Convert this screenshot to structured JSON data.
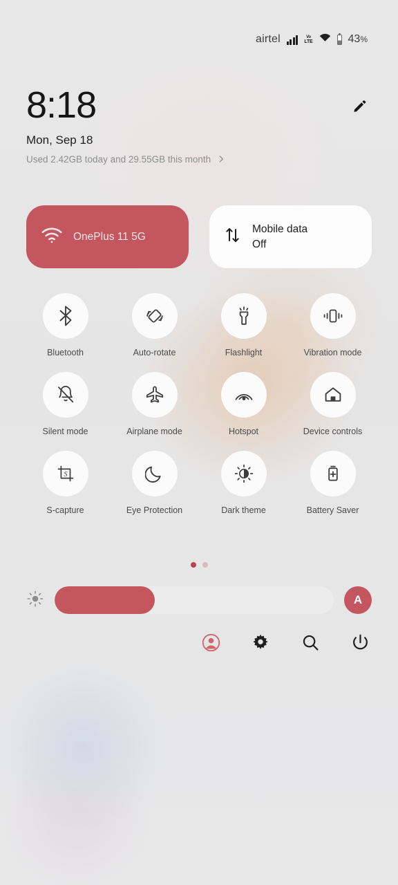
{
  "statusbar": {
    "carrier": "airtel",
    "signal_icon": "signal-bars-icon",
    "volte_top": "VoLTE",
    "volte_line1": "Vo",
    "volte_line2": "LTE",
    "wifi_icon": "wifi-icon",
    "battery_icon": "battery-icon",
    "battery_percent": "43",
    "battery_percent_symbol": "%"
  },
  "header": {
    "clock": "8:18",
    "date": "Mon, Sep 18",
    "data_usage": "Used 2.42GB today and 29.55GB this month",
    "chevron_icon": "chevron-right-icon",
    "edit_icon": "edit-pencil-icon"
  },
  "big_tiles": [
    {
      "id": "wifi",
      "icon": "wifi-icon",
      "title": "OnePlus 11 5G",
      "subtitle": "",
      "state": "on"
    },
    {
      "id": "mobile-data",
      "icon": "mobile-data-arrows-icon",
      "title": "Mobile data",
      "subtitle": "Off",
      "state": "off"
    }
  ],
  "toggles": [
    {
      "id": "bluetooth",
      "label": "Bluetooth",
      "icon": "bluetooth-icon"
    },
    {
      "id": "auto-rotate",
      "label": "Auto-rotate",
      "icon": "auto-rotate-icon"
    },
    {
      "id": "flashlight",
      "label": "Flashlight",
      "icon": "flashlight-icon"
    },
    {
      "id": "vibration-mode",
      "label": "Vibration mode",
      "icon": "vibration-icon"
    },
    {
      "id": "silent-mode",
      "label": "Silent mode",
      "icon": "bell-off-icon"
    },
    {
      "id": "airplane-mode",
      "label": "Airplane mode",
      "icon": "airplane-icon"
    },
    {
      "id": "hotspot",
      "label": "Hotspot",
      "icon": "hotspot-icon"
    },
    {
      "id": "device-controls",
      "label": "Device controls",
      "icon": "home-icon"
    },
    {
      "id": "s-capture",
      "label": "S-capture",
      "icon": "screenshot-icon"
    },
    {
      "id": "eye-protection",
      "label": "Eye Protection",
      "icon": "moon-icon"
    },
    {
      "id": "dark-theme",
      "label": "Dark theme",
      "icon": "brightness-contrast-icon"
    },
    {
      "id": "battery-saver",
      "label": "Battery Saver",
      "icon": "battery-plus-icon"
    }
  ],
  "pager": {
    "pages": 2,
    "active": 1
  },
  "brightness": {
    "icon": "brightness-sun-icon",
    "percent": 36,
    "auto_label": "A"
  },
  "actions": [
    {
      "id": "user",
      "icon": "user-account-icon"
    },
    {
      "id": "settings",
      "icon": "gear-icon"
    },
    {
      "id": "search",
      "icon": "search-icon"
    },
    {
      "id": "power",
      "icon": "power-icon"
    }
  ],
  "colors": {
    "accent": "#c4565f",
    "tile_off": "#fdfdfd",
    "background": "#e6e6e6",
    "label": "#4a4a4a"
  }
}
